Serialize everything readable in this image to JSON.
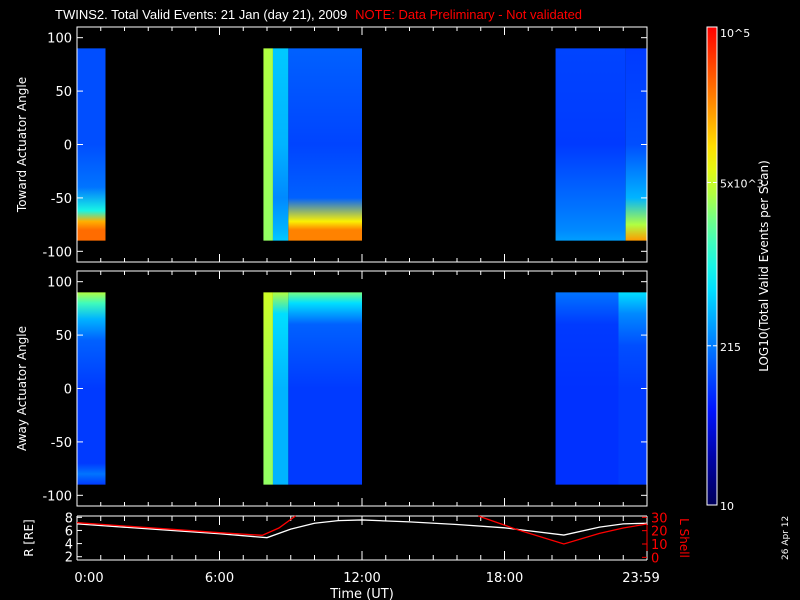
{
  "title": "TWINS2. Total Valid Events: 21 Jan (day  21), 2009",
  "note": "NOTE: Data Preliminary - Not validated",
  "date_stamp": "26 Apr 12",
  "chart_data": [
    {
      "type": "heatmap",
      "name": "toward",
      "ylabel": "Toward Actuator Angle",
      "ylim": [
        -110,
        110
      ],
      "yticks": [
        100,
        50,
        0,
        -50,
        -100
      ],
      "xlim_hours": [
        0,
        24
      ],
      "blocks": [
        {
          "t0": 0.0,
          "t1": 1.2,
          "profile": [
            [
              90,
              2.1
            ],
            [
              0,
              2.1
            ],
            [
              -40,
              2.3
            ],
            [
              -62,
              3.0
            ],
            [
              -72,
              4.2
            ],
            [
              -80,
              4.5
            ],
            [
              -90,
              4.5
            ]
          ]
        },
        {
          "t0": 7.85,
          "t1": 8.25,
          "profile": [
            [
              90,
              3.6
            ],
            [
              0,
              3.55
            ],
            [
              -90,
              3.5
            ]
          ]
        },
        {
          "t0": 8.25,
          "t1": 8.9,
          "profile": [
            [
              90,
              2.7
            ],
            [
              0,
              2.6
            ],
            [
              -50,
              2.4
            ],
            [
              -80,
              2.6
            ],
            [
              -90,
              2.7
            ]
          ]
        },
        {
          "t0": 8.9,
          "t1": 12.0,
          "profile": [
            [
              90,
              2.2
            ],
            [
              0,
              2.05
            ],
            [
              -50,
              2.2
            ],
            [
              -72,
              3.9
            ],
            [
              -80,
              4.4
            ],
            [
              -90,
              4.4
            ]
          ]
        },
        {
          "t0": 20.15,
          "t1": 23.1,
          "profile": [
            [
              90,
              2.05
            ],
            [
              0,
              2.0
            ],
            [
              -60,
              2.3
            ],
            [
              -80,
              2.4
            ],
            [
              -90,
              2.5
            ]
          ]
        },
        {
          "t0": 23.1,
          "t1": 24.0,
          "profile": [
            [
              90,
              2.0
            ],
            [
              0,
              2.1
            ],
            [
              -50,
              2.6
            ],
            [
              -75,
              3.6
            ],
            [
              -90,
              4.3
            ]
          ]
        }
      ]
    },
    {
      "type": "heatmap",
      "name": "away",
      "ylabel": "Away Actuator Angle",
      "ylim": [
        -110,
        110
      ],
      "yticks": [
        100,
        50,
        0,
        -50,
        -100
      ],
      "xlim_hours": [
        0,
        24
      ],
      "blocks": [
        {
          "t0": 0.0,
          "t1": 1.2,
          "profile": [
            [
              90,
              3.6
            ],
            [
              80,
              3.2
            ],
            [
              65,
              2.6
            ],
            [
              45,
              2.2
            ],
            [
              0,
              2.0
            ],
            [
              -70,
              2.0
            ],
            [
              -80,
              2.3
            ],
            [
              -90,
              2.0
            ]
          ]
        },
        {
          "t0": 7.85,
          "t1": 8.25,
          "profile": [
            [
              90,
              3.7
            ],
            [
              0,
              3.55
            ],
            [
              -90,
              3.5
            ]
          ]
        },
        {
          "t0": 8.25,
          "t1": 8.9,
          "profile": [
            [
              90,
              3.6
            ],
            [
              70,
              2.8
            ],
            [
              0,
              2.6
            ],
            [
              -90,
              2.6
            ]
          ]
        },
        {
          "t0": 8.9,
          "t1": 12.0,
          "profile": [
            [
              90,
              3.4
            ],
            [
              80,
              2.8
            ],
            [
              60,
              2.2
            ],
            [
              0,
              2.0
            ],
            [
              -90,
              2.0
            ]
          ]
        },
        {
          "t0": 20.15,
          "t1": 22.8,
          "profile": [
            [
              90,
              2.3
            ],
            [
              60,
              2.0
            ],
            [
              0,
              1.95
            ],
            [
              -90,
              1.95
            ]
          ]
        },
        {
          "t0": 22.8,
          "t1": 24.0,
          "profile": [
            [
              90,
              2.8
            ],
            [
              70,
              2.4
            ],
            [
              40,
              2.1
            ],
            [
              0,
              2.0
            ],
            [
              -90,
              2.0
            ]
          ]
        }
      ]
    },
    {
      "type": "line",
      "name": "orbit",
      "xlabel": "Time (UT)",
      "xticks": [
        "0:00",
        "6:00",
        "12:00",
        "18:00",
        "23:59"
      ],
      "ylabel_left": "R [RE]",
      "yticks_left": [
        2,
        4,
        6,
        8
      ],
      "ylim_left": [
        1.5,
        8.2
      ],
      "ylabel_right": "L Shell",
      "yticks_right": [
        0,
        10,
        20,
        30
      ],
      "ylim_right": [
        -2,
        31
      ],
      "series": [
        {
          "name": "R",
          "axis": "left",
          "color": "#ffffff",
          "points": [
            [
              0,
              7.0
            ],
            [
              2,
              6.5
            ],
            [
              4,
              6.0
            ],
            [
              6,
              5.5
            ],
            [
              8,
              4.9
            ],
            [
              9,
              6.2
            ],
            [
              10,
              7.1
            ],
            [
              11,
              7.5
            ],
            [
              12,
              7.6
            ],
            [
              14,
              7.3
            ],
            [
              16,
              6.9
            ],
            [
              18,
              6.4
            ],
            [
              20.5,
              5.3
            ],
            [
              22,
              6.5
            ],
            [
              23,
              7.0
            ],
            [
              24,
              7.1
            ]
          ]
        },
        {
          "name": "L Shell",
          "axis": "right",
          "color": "#ff0000",
          "points": [
            [
              0,
              26
            ],
            [
              2,
              23.5
            ],
            [
              4,
              21
            ],
            [
              6,
              18.5
            ],
            [
              7.8,
              16.5
            ],
            [
              8.5,
              22
            ],
            [
              9.2,
              31
            ]
          ],
          "points2": [
            [
              16.9,
              31
            ],
            [
              18.5,
              21
            ],
            [
              20.5,
              10
            ],
            [
              22,
              18
            ],
            [
              23,
              22
            ],
            [
              24,
              25
            ]
          ]
        }
      ]
    },
    {
      "type": "colorbar",
      "label": "LOG10(Total Valid Events per Scan)",
      "log_range": [
        1,
        5
      ],
      "ticks": [
        {
          "value": 10,
          "label": "10"
        },
        {
          "value": 215,
          "label": "215"
        },
        {
          "value": 5000,
          "label": "5x10^3"
        },
        {
          "value": 100000,
          "label": "10^5"
        }
      ]
    }
  ]
}
